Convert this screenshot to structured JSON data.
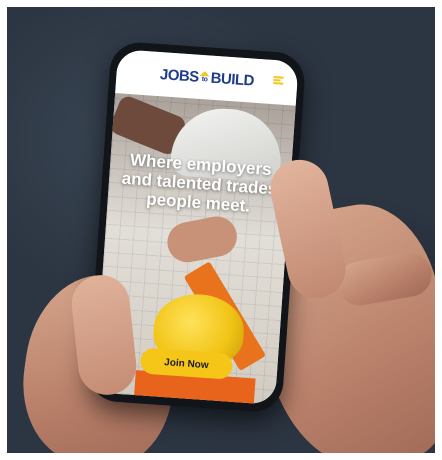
{
  "header": {
    "logo": {
      "part1": "JOBS",
      "part2": "to",
      "part3": "BUILD"
    },
    "menu_icon": "hamburger-menu-icon",
    "accent_color": "#f5c518",
    "brand_color": "#1f3d8a"
  },
  "hero": {
    "headline": "Where employers and talented trades people meet.",
    "cta_label": "Join Now"
  }
}
